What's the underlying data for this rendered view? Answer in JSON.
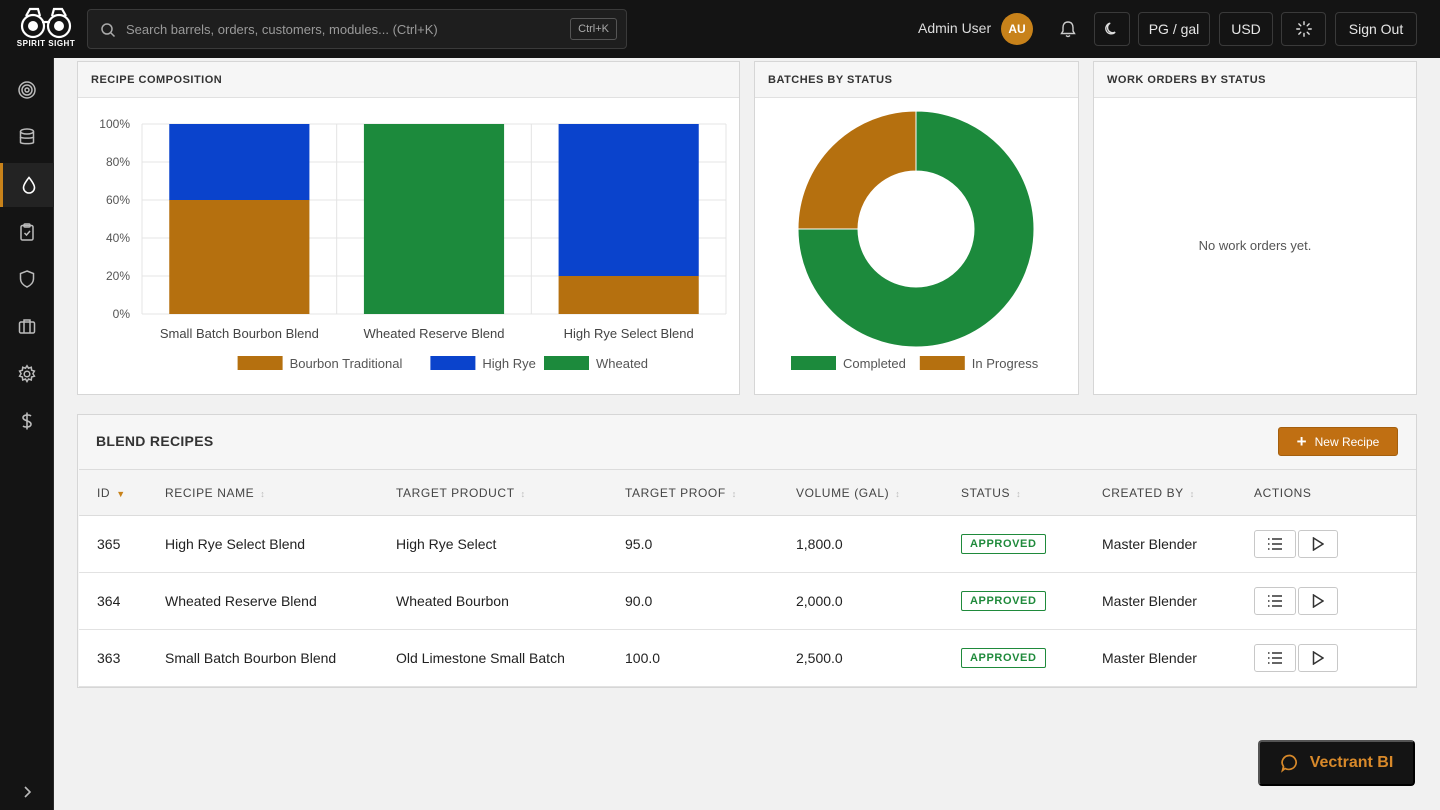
{
  "header": {
    "logo_text": "SPIRIT SIGHT",
    "search": {
      "placeholder": "Search barrels, orders, customers, modules... (Ctrl+K)",
      "shortcut": "Ctrl+K"
    },
    "user_name": "Admin User",
    "avatar_initials": "AU",
    "units_label": "PG / gal",
    "currency_label": "USD",
    "sign_out_label": "Sign Out"
  },
  "sidebar": {
    "items": [
      {
        "icon": "target-icon",
        "active": false
      },
      {
        "icon": "database-icon",
        "active": false
      },
      {
        "icon": "droplet-icon",
        "active": true
      },
      {
        "icon": "clipboard-icon",
        "active": false
      },
      {
        "icon": "shield-icon",
        "active": false
      },
      {
        "icon": "briefcase-icon",
        "active": false
      },
      {
        "icon": "gear-icon",
        "active": false
      },
      {
        "icon": "dollar-icon",
        "active": false
      }
    ]
  },
  "panels": {
    "recipe_composition_title": "RECIPE COMPOSITION",
    "batches_title": "BATCHES BY STATUS",
    "work_orders_title": "WORK ORDERS BY STATUS",
    "work_orders_empty": "No work orders yet."
  },
  "chart_data": [
    {
      "type": "bar",
      "stacked": true,
      "categories": [
        "Small Batch Bourbon Blend",
        "Wheated Reserve Blend",
        "High Rye Select Blend"
      ],
      "series": [
        {
          "name": "Bourbon Traditional",
          "color": "#b5700f",
          "values": [
            60,
            0,
            20
          ]
        },
        {
          "name": "High Rye",
          "color": "#0a43cc",
          "values": [
            40,
            0,
            80
          ]
        },
        {
          "name": "Wheated",
          "color": "#1c8a3c",
          "values": [
            0,
            100,
            0
          ]
        }
      ],
      "ylim": [
        0,
        100
      ],
      "yticks": [
        "0%",
        "20%",
        "40%",
        "60%",
        "80%",
        "100%"
      ],
      "grid": true,
      "legend": "bottom"
    },
    {
      "type": "pie",
      "donut": true,
      "series": [
        {
          "name": "Completed",
          "color": "#1c8a3c",
          "value": 3
        },
        {
          "name": "In Progress",
          "color": "#b5700f",
          "value": 1
        }
      ],
      "legend": "bottom"
    }
  ],
  "recipes": {
    "title": "BLEND RECIPES",
    "new_label": "New Recipe",
    "columns": [
      "ID",
      "RECIPE NAME",
      "TARGET PRODUCT",
      "TARGET PROOF",
      "VOLUME (GAL)",
      "STATUS",
      "CREATED BY",
      "ACTIONS"
    ],
    "rows": [
      {
        "id": "365",
        "name": "High Rye Select Blend",
        "product": "High Rye Select",
        "proof": "95.0",
        "volume": "1,800.0",
        "status": "APPROVED",
        "created_by": "Master Blender"
      },
      {
        "id": "364",
        "name": "Wheated Reserve Blend",
        "product": "Wheated Bourbon",
        "proof": "90.0",
        "volume": "2,000.0",
        "status": "APPROVED",
        "created_by": "Master Blender"
      },
      {
        "id": "363",
        "name": "Small Batch Bourbon Blend",
        "product": "Old Limestone Small Batch",
        "proof": "100.0",
        "volume": "2,500.0",
        "status": "APPROVED",
        "created_by": "Master Blender"
      }
    ]
  },
  "bi_button_label": "Vectrant BI"
}
